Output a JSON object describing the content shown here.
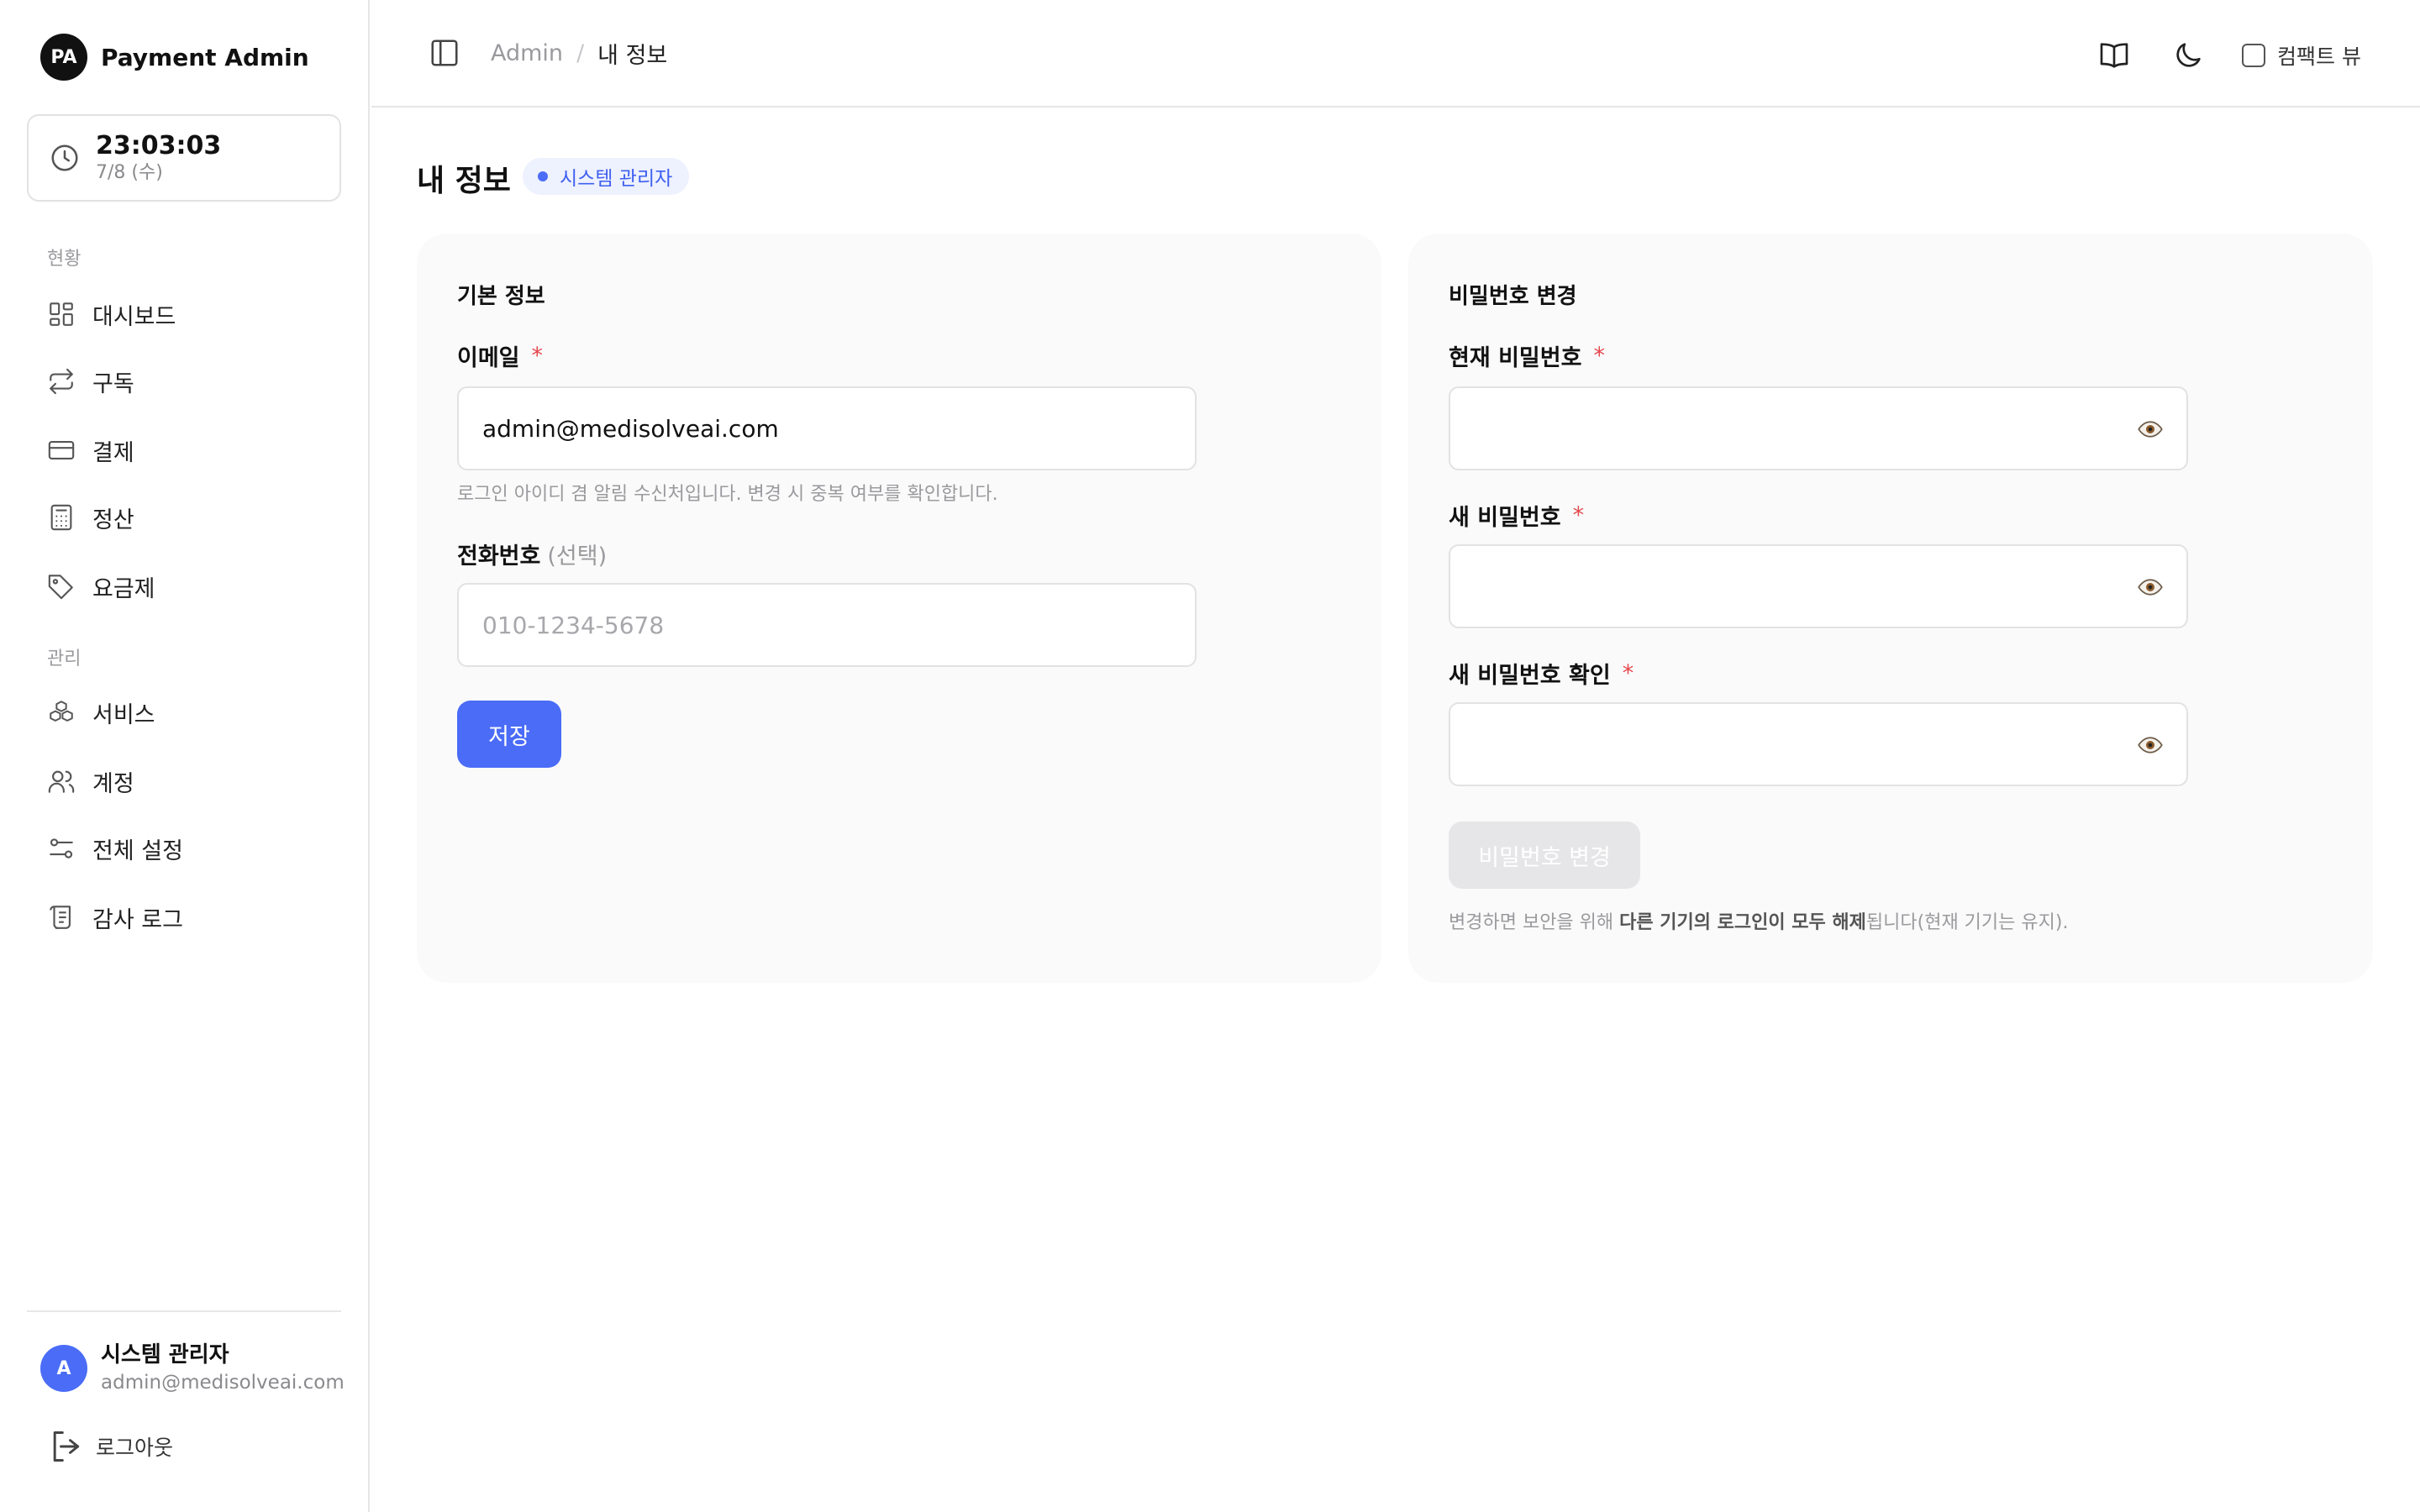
{
  "brand": {
    "initials": "PA",
    "title": "Payment Admin"
  },
  "clock": {
    "time": "23:03:03",
    "date": "7/8 (수)",
    "icon": "clock-icon"
  },
  "sidebar": {
    "section_status": "현황",
    "section_manage": "관리",
    "items": [
      {
        "label": "대시보드",
        "icon": "dashboard-icon"
      },
      {
        "label": "구독",
        "icon": "repeat-icon"
      },
      {
        "label": "결제",
        "icon": "credit-card-icon"
      },
      {
        "label": "정산",
        "icon": "calculator-icon"
      },
      {
        "label": "요금제",
        "icon": "tag-icon"
      },
      {
        "label": "서비스",
        "icon": "boxes-icon"
      },
      {
        "label": "계정",
        "icon": "users-icon"
      },
      {
        "label": "전체 설정",
        "icon": "sliders-icon"
      },
      {
        "label": "감사 로그",
        "icon": "scroll-icon"
      }
    ]
  },
  "user": {
    "initial": "A",
    "name": "시스템 관리자",
    "email": "admin@medisolveai.com"
  },
  "logout_label": "로그아웃",
  "topbar": {
    "breadcrumb_root": "Admin",
    "breadcrumb_sep": "/",
    "breadcrumb_current": "내 정보",
    "compact_label": "컴팩트 뷰"
  },
  "page": {
    "title": "내 정보",
    "role_badge": "시스템 관리자"
  },
  "basic_info": {
    "title": "기본 정보",
    "email_label": "이메일",
    "required_mark": "*",
    "email_value": "admin@medisolveai.com",
    "email_hint": "로그인 아이디 겸 알림 수신처입니다. 변경 시 중복 여부를 확인합니다.",
    "phone_label": "전화번호",
    "phone_optional": "(선택)",
    "phone_placeholder": "010-1234-5678",
    "save_label": "저장"
  },
  "password": {
    "title": "비밀번호 변경",
    "current_label": "현재 비밀번호",
    "new_label": "새 비밀번호",
    "confirm_label": "새 비밀번호 확인",
    "required_mark": "*",
    "submit_label": "비밀번호 변경",
    "note_prefix": "변경하면 보안을 위해 ",
    "note_bold": "다른 기기의 로그인이 모두 해제",
    "note_suffix": "됩니다(현재 기기는 유지)."
  },
  "colors": {
    "accent": "#4a6cf7",
    "required": "#e5484d",
    "card_bg": "#fafafa"
  }
}
